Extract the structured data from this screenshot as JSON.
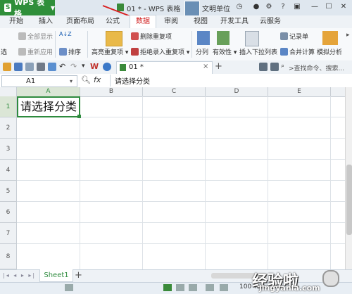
{
  "titlebar": {
    "app_button": "WPS 表格",
    "doc_title": "01 * - WPS 表格",
    "user": "文明单位"
  },
  "tabs": [
    "开始",
    "插入",
    "页面布局",
    "公式",
    "数据",
    "审阅",
    "视图",
    "开发工具",
    "云服务"
  ],
  "active_tab": "数据",
  "ribbon": {
    "show_all": "全部显示",
    "reapply": "重新应用",
    "sort": "排序",
    "partial_filter": "选",
    "highlight_duplicates": "高亮重复项",
    "remove_duplicates": "删除重复项",
    "reject_duplicates": "拒绝录入重复项",
    "split": "分列",
    "validity": "有效性",
    "insert_dropdown": "插入下拉列表",
    "record_form": "记录单",
    "consolidate": "合并计算",
    "simulate": "模拟分析"
  },
  "quickbar": {
    "doc_tab": "01 *",
    "add_tab": "+",
    "search_placeholder": ">查找命令、搜索..."
  },
  "formula_bar": {
    "cell_ref": "A1",
    "fx": "fx",
    "content": "请选择分类"
  },
  "columns": [
    "A",
    "B",
    "C",
    "D",
    "E"
  ],
  "rows": [
    "1",
    "2",
    "3",
    "4",
    "5",
    "6",
    "7",
    "8"
  ],
  "cells": {
    "A1": "请选择分类"
  },
  "sheets": [
    "Sheet1"
  ],
  "add_sheet": "+",
  "zoom": "100 %",
  "watermark": {
    "text": "经验啦",
    "url": "jingyanla.com"
  },
  "colors": {
    "accent": "#2f8f3a",
    "active_tab_text": "#d02020",
    "selection": "#2e8b3e"
  }
}
